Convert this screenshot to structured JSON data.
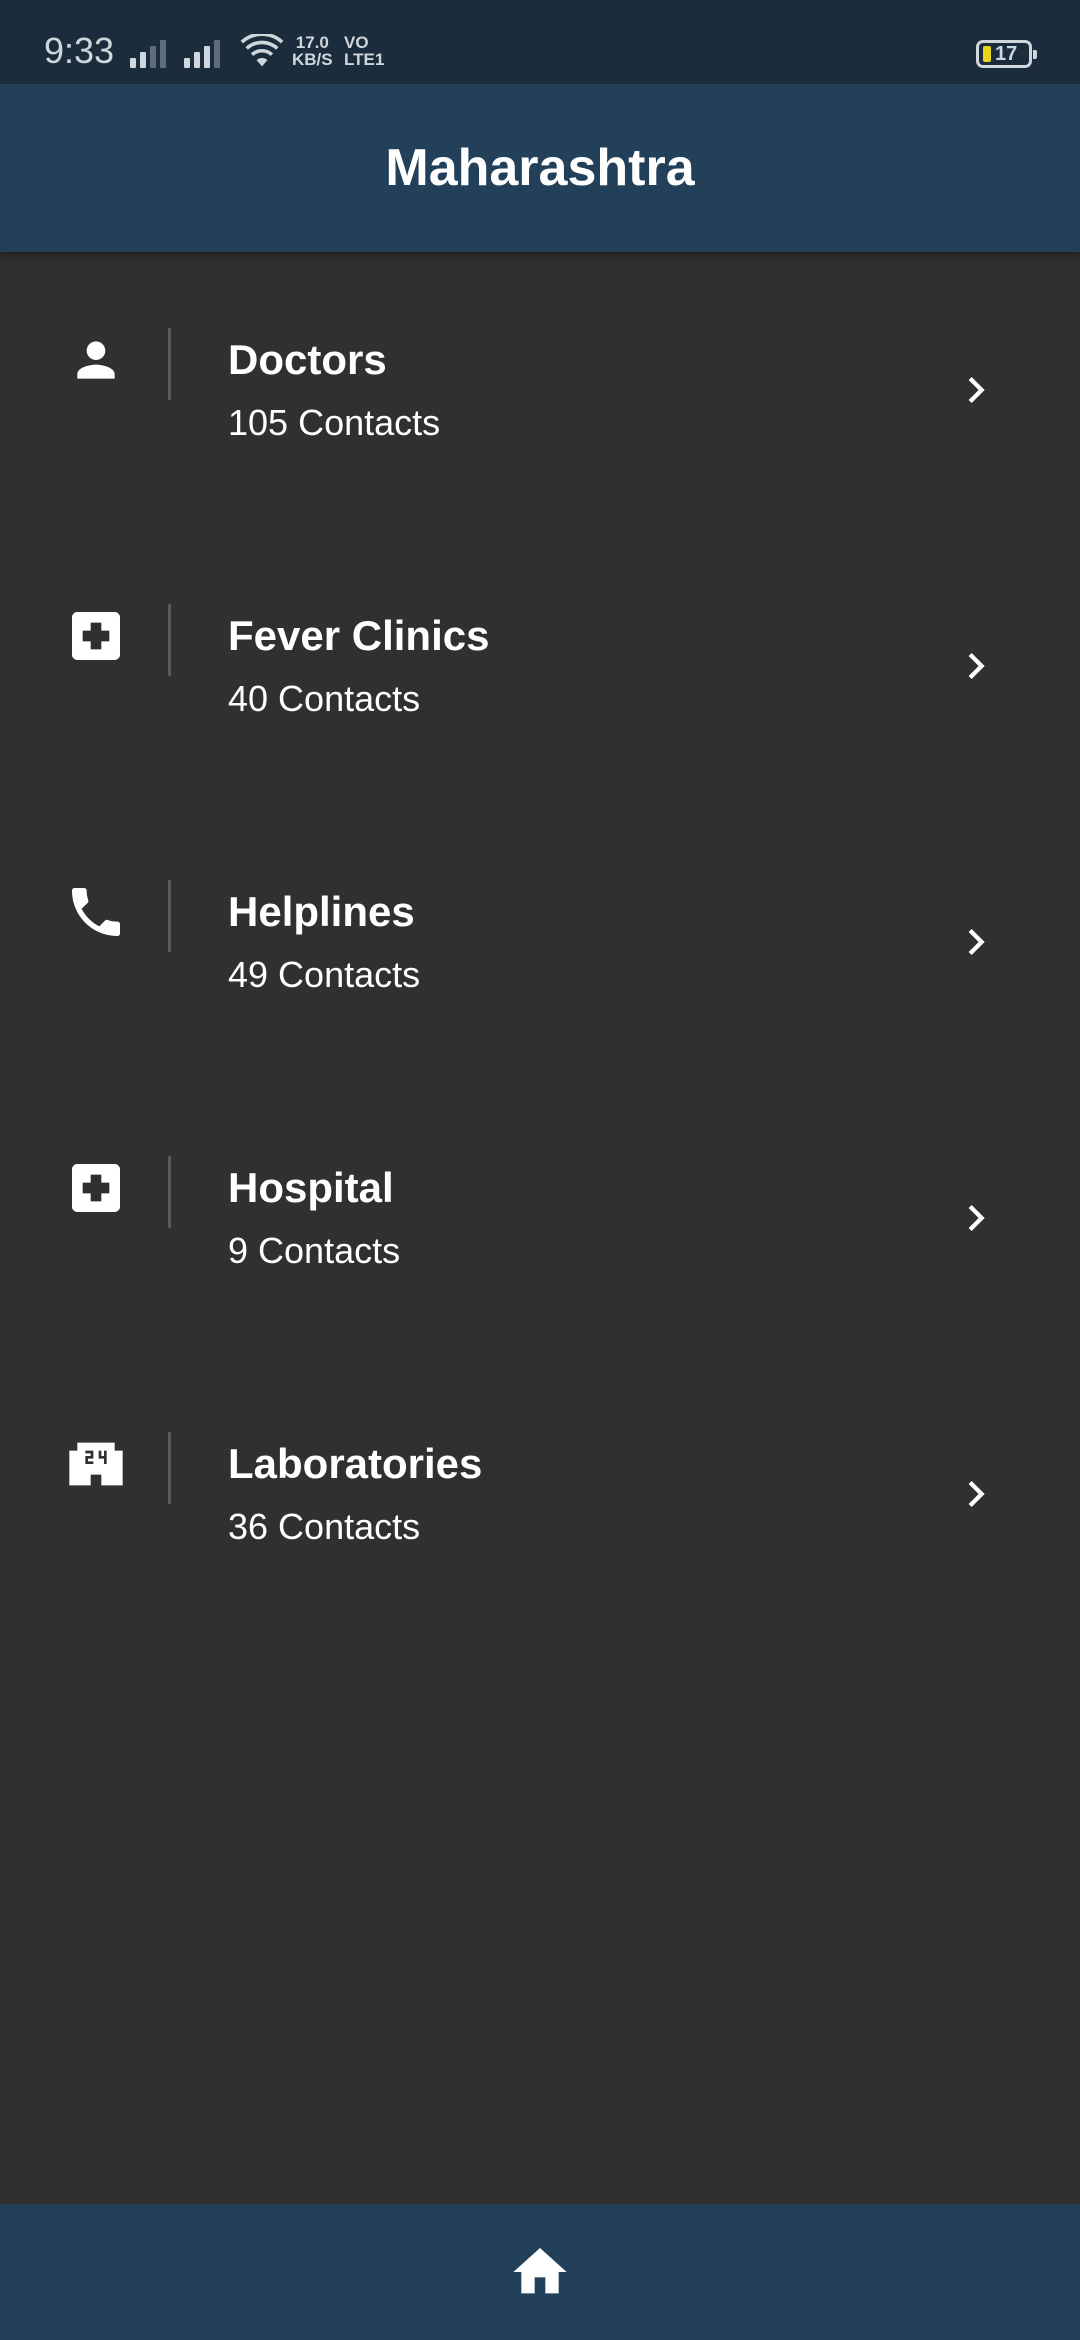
{
  "status_bar": {
    "time": "9:33",
    "net_speed_value": "17.0",
    "net_speed_unit": "KB/S",
    "volte_top": "VO",
    "volte_bottom": "LTE1",
    "battery": "17",
    "battery_color": "#e8d51b"
  },
  "app_bar": {
    "title": "Maharashtra",
    "color": "#22405a"
  },
  "categories": [
    {
      "title": "Doctors",
      "subtitle": "105 Contacts",
      "icon": "person-icon"
    },
    {
      "title": "Fever Clinics",
      "subtitle": "40 Contacts",
      "icon": "medical-cross-icon"
    },
    {
      "title": "Helplines",
      "subtitle": "49 Contacts",
      "icon": "phone-icon"
    },
    {
      "title": "Hospital",
      "subtitle": "9 Contacts",
      "icon": "medical-cross-icon"
    },
    {
      "title": "Laboratories",
      "subtitle": "36 Contacts",
      "icon": "local-convenience-store-24-icon"
    }
  ],
  "bottom_nav": {
    "icon": "home-icon",
    "color": "#22405a"
  }
}
